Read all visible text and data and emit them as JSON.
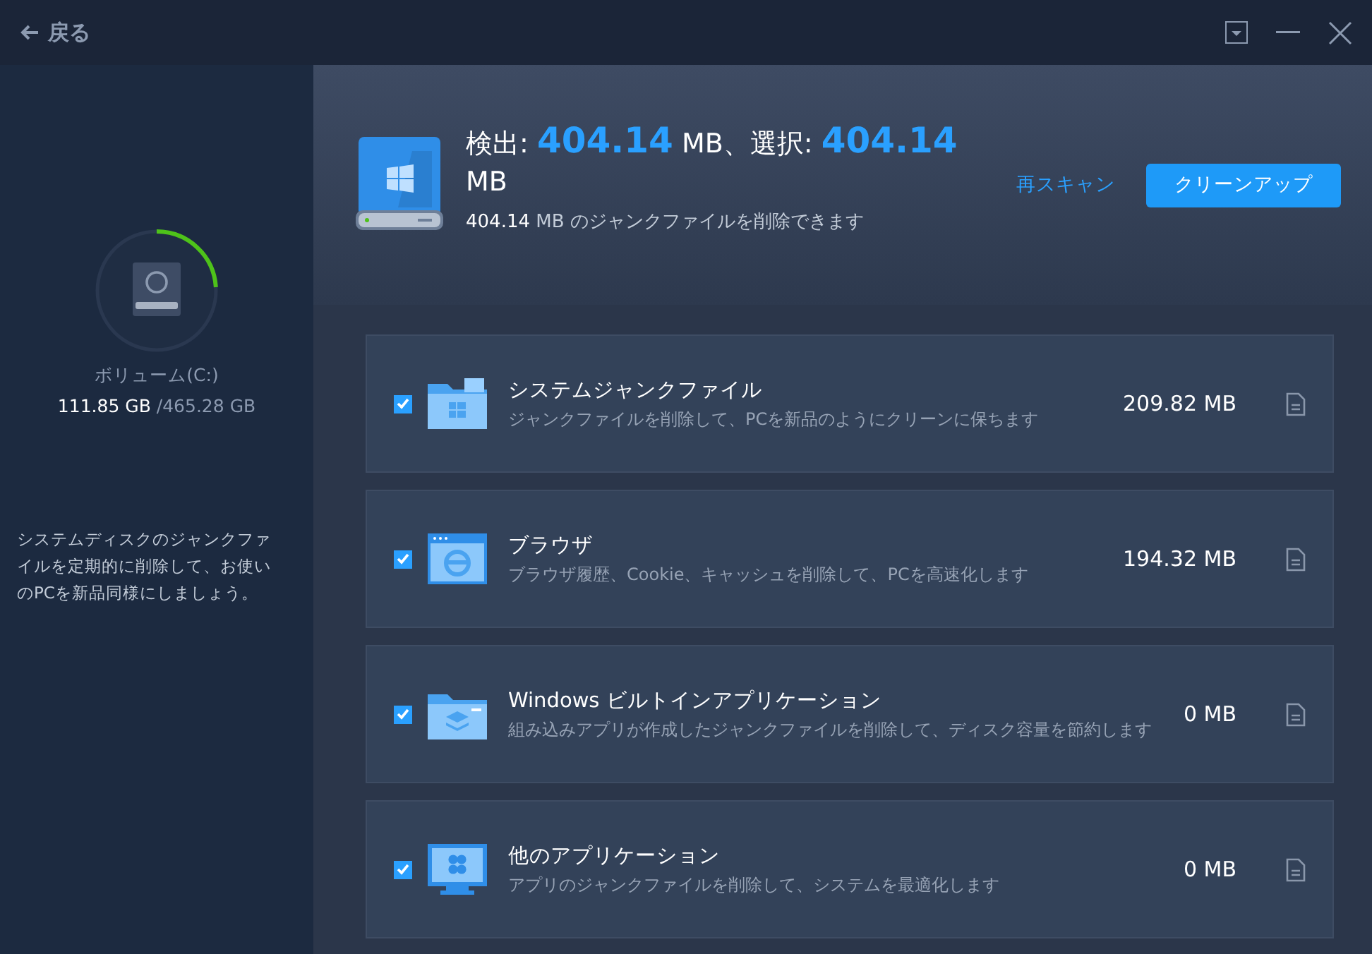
{
  "titlebar": {
    "back": "戻る"
  },
  "volume": {
    "name": "ボリューム(C:)",
    "used": "111.85 GB",
    "total": "/465.28 GB",
    "level": 0.24
  },
  "tip": "システムディスクのジャンクファイルを定期的に削除して、お使いのPCを新品同様にしましょう。",
  "summary": {
    "headline": "検出: **404.14** MB、選択: **404.14** MB",
    "subline": "**404.14** MB のジャンクファイルを削除できます",
    "rescan": "再スキャン",
    "cleanup": "クリーンアップ"
  },
  "items": [
    {
      "kind": "system",
      "title": "システムジャンクファイル",
      "description": "ジャンクファイルを削除して、PCを新品のようにクリーンに保ちます",
      "size": "209.82 MB",
      "checked": true
    },
    {
      "kind": "browser",
      "title": "ブラウザ",
      "description": "ブラウザ履歴、Cookie、キャッシュを削除して、PCを高速化します",
      "size": "194.32 MB",
      "checked": true
    },
    {
      "kind": "builtin",
      "title": "Windows ビルトインアプリケーション",
      "description": "組み込みアプリが作成したジャンクファイルを削除して、ディスク容量を節約します",
      "size": "0 MB",
      "checked": true
    },
    {
      "kind": "apps",
      "title": "他のアプリケーション",
      "description": "アプリのジャンクファイルを削除して、システムを最適化します",
      "size": "0 MB",
      "checked": true
    }
  ]
}
